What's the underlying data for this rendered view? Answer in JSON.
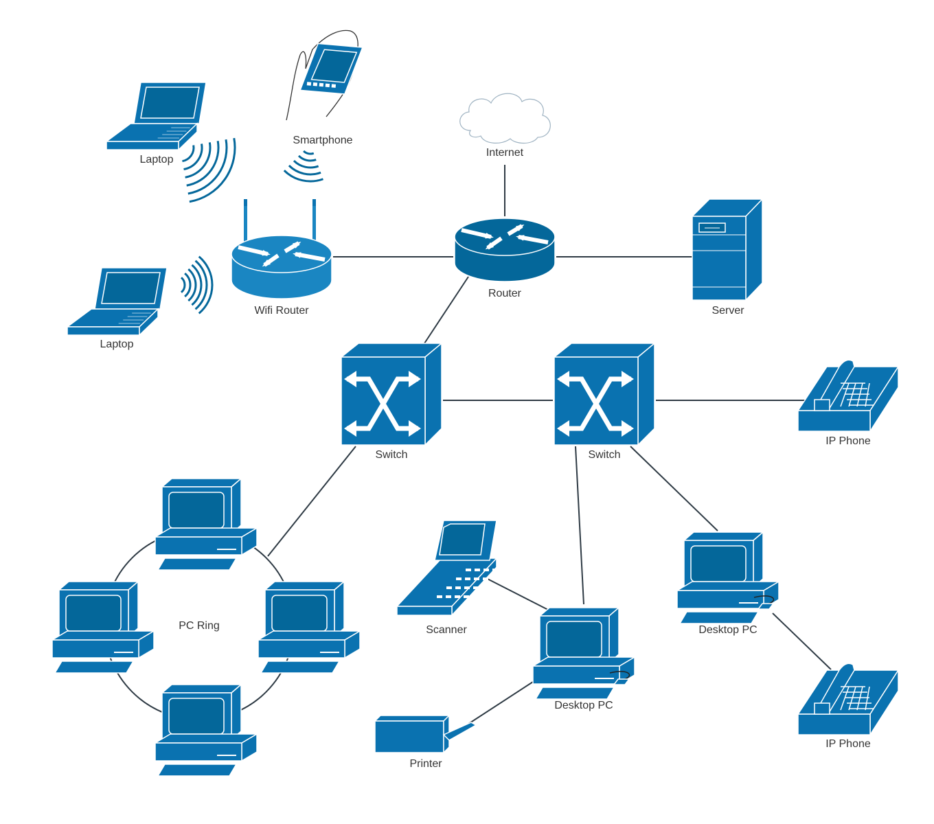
{
  "colors": {
    "device": "#0a72b0",
    "device_dark": "#04679a",
    "device_light": "#1a86c2",
    "line": "#2e3a44",
    "cloud_stroke": "#9fb3c2",
    "label": "#333333"
  },
  "nodes": [
    {
      "id": "laptop1",
      "type": "laptop",
      "label": "Laptop"
    },
    {
      "id": "smartphone",
      "type": "smartphone",
      "label": "Smartphone"
    },
    {
      "id": "internet",
      "type": "cloud",
      "label": "Internet"
    },
    {
      "id": "wifi",
      "type": "wifi-router",
      "label": "Wifi Router"
    },
    {
      "id": "laptop2",
      "type": "laptop",
      "label": "Laptop"
    },
    {
      "id": "router",
      "type": "router",
      "label": "Router"
    },
    {
      "id": "server",
      "type": "server",
      "label": "Server"
    },
    {
      "id": "switch1",
      "type": "switch",
      "label": "Switch"
    },
    {
      "id": "switch2",
      "type": "switch",
      "label": "Switch"
    },
    {
      "id": "ipphone1",
      "type": "ip-phone",
      "label": "IP Phone"
    },
    {
      "id": "ring",
      "type": "pc-ring",
      "label": "PC Ring"
    },
    {
      "id": "scanner",
      "type": "scanner",
      "label": "Scanner"
    },
    {
      "id": "desktop1",
      "type": "desktop-pc",
      "label": "Desktop PC"
    },
    {
      "id": "desktop2",
      "type": "desktop-pc",
      "label": "Desktop PC"
    },
    {
      "id": "printer",
      "type": "printer",
      "label": "Printer"
    },
    {
      "id": "ipphone2",
      "type": "ip-phone",
      "label": "IP Phone"
    }
  ],
  "edges": [
    [
      "wifi",
      "router"
    ],
    [
      "internet",
      "router"
    ],
    [
      "router",
      "server"
    ],
    [
      "router",
      "switch1"
    ],
    [
      "switch1",
      "switch2"
    ],
    [
      "switch2",
      "ipphone1"
    ],
    [
      "switch1",
      "ring"
    ],
    [
      "switch2",
      "desktop1"
    ],
    [
      "switch2",
      "desktop2"
    ],
    [
      "scanner",
      "desktop1"
    ],
    [
      "printer",
      "desktop1"
    ],
    [
      "desktop2",
      "ipphone2"
    ]
  ],
  "wireless": [
    [
      "laptop1",
      "wifi"
    ],
    [
      "smartphone",
      "wifi"
    ],
    [
      "laptop2",
      "wifi"
    ]
  ]
}
